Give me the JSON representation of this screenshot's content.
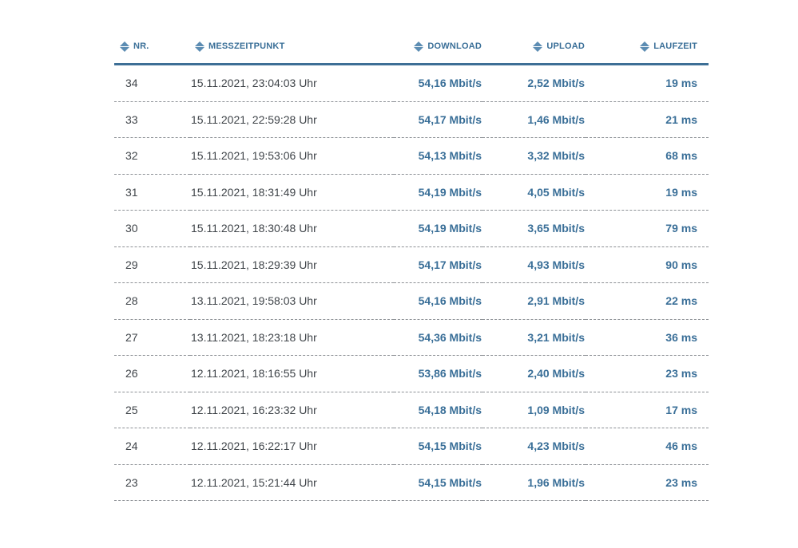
{
  "colors": {
    "accent": "#3a6f98",
    "header_rule": "#3d6f96",
    "sort_icon": "#5d8db3",
    "text": "#3f4449",
    "row_divider": "#8c9095"
  },
  "table": {
    "headers": {
      "nr": "NR.",
      "timestamp": "MESSZEITPUNKT",
      "download": "DOWNLOAD",
      "upload": "UPLOAD",
      "latency": "LAUFZEIT"
    },
    "rows": [
      {
        "nr": "34",
        "timestamp": "15.11.2021, 23:04:03 Uhr",
        "download": "54,16 Mbit/s",
        "upload": "2,52 Mbit/s",
        "latency": "19 ms"
      },
      {
        "nr": "33",
        "timestamp": "15.11.2021, 22:59:28 Uhr",
        "download": "54,17 Mbit/s",
        "upload": "1,46 Mbit/s",
        "latency": "21 ms"
      },
      {
        "nr": "32",
        "timestamp": "15.11.2021, 19:53:06 Uhr",
        "download": "54,13 Mbit/s",
        "upload": "3,32 Mbit/s",
        "latency": "68 ms"
      },
      {
        "nr": "31",
        "timestamp": "15.11.2021, 18:31:49 Uhr",
        "download": "54,19 Mbit/s",
        "upload": "4,05 Mbit/s",
        "latency": "19 ms"
      },
      {
        "nr": "30",
        "timestamp": "15.11.2021, 18:30:48 Uhr",
        "download": "54,19 Mbit/s",
        "upload": "3,65 Mbit/s",
        "latency": "79 ms"
      },
      {
        "nr": "29",
        "timestamp": "15.11.2021, 18:29:39 Uhr",
        "download": "54,17 Mbit/s",
        "upload": "4,93 Mbit/s",
        "latency": "90 ms"
      },
      {
        "nr": "28",
        "timestamp": "13.11.2021, 19:58:03 Uhr",
        "download": "54,16 Mbit/s",
        "upload": "2,91 Mbit/s",
        "latency": "22 ms"
      },
      {
        "nr": "27",
        "timestamp": "13.11.2021, 18:23:18 Uhr",
        "download": "54,36 Mbit/s",
        "upload": "3,21 Mbit/s",
        "latency": "36 ms"
      },
      {
        "nr": "26",
        "timestamp": "12.11.2021, 18:16:55 Uhr",
        "download": "53,86 Mbit/s",
        "upload": "2,40 Mbit/s",
        "latency": "23 ms"
      },
      {
        "nr": "25",
        "timestamp": "12.11.2021, 16:23:32 Uhr",
        "download": "54,18 Mbit/s",
        "upload": "1,09 Mbit/s",
        "latency": "17 ms"
      },
      {
        "nr": "24",
        "timestamp": "12.11.2021, 16:22:17 Uhr",
        "download": "54,15 Mbit/s",
        "upload": "4,23 Mbit/s",
        "latency": "46 ms"
      },
      {
        "nr": "23",
        "timestamp": "12.11.2021, 15:21:44 Uhr",
        "download": "54,15 Mbit/s",
        "upload": "1,96 Mbit/s",
        "latency": "23 ms"
      }
    ]
  }
}
